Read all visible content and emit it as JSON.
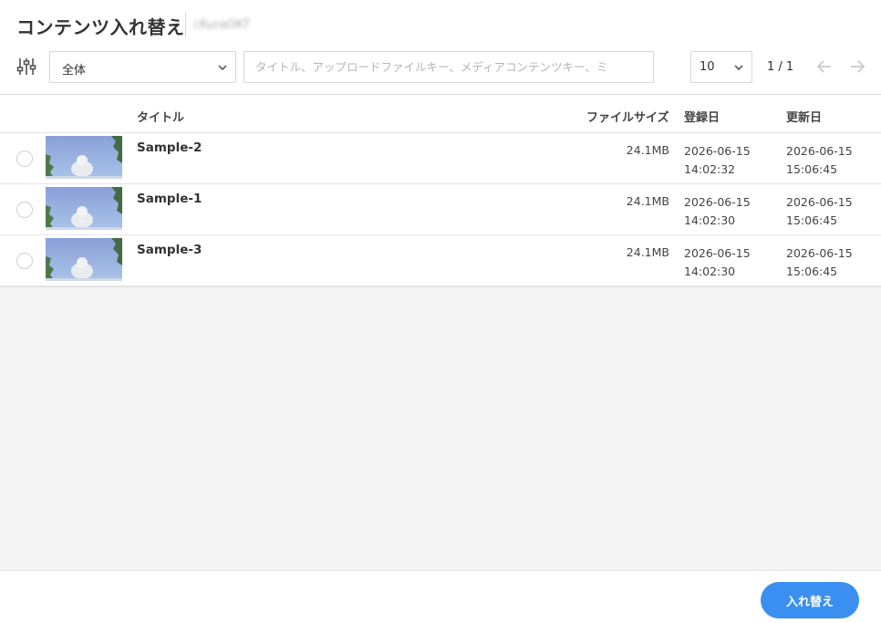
{
  "header": {
    "title": "コンテンツ入れ替え",
    "subtitle": "cKuraOKT"
  },
  "toolbar": {
    "filter_icon": "sliders-icon",
    "category_select": {
      "selected": "全体"
    },
    "search": {
      "placeholder": "タイトル、アップロードファイルキー、メディアコンテンツキー、ミ",
      "value": ""
    },
    "per_page": {
      "selected": "10"
    },
    "page_info": "1 / 1"
  },
  "table": {
    "columns": {
      "title": "タイトル",
      "file_size": "ファイルサイズ",
      "registered": "登録日",
      "updated": "更新日"
    },
    "rows": [
      {
        "title": "Sample-2",
        "size": "24.1MB",
        "registered_date": "2026-06-15",
        "registered_time": "14:02:32",
        "updated_date": "2026-06-15",
        "updated_time": "15:06:45"
      },
      {
        "title": "Sample-1",
        "size": "24.1MB",
        "registered_date": "2026-06-15",
        "registered_time": "14:02:30",
        "updated_date": "2026-06-15",
        "updated_time": "15:06:45"
      },
      {
        "title": "Sample-3",
        "size": "24.1MB",
        "registered_date": "2026-06-15",
        "registered_time": "14:02:30",
        "updated_date": "2026-06-15",
        "updated_time": "15:06:45"
      }
    ]
  },
  "footer": {
    "replace_label": "入れ替え"
  },
  "colors": {
    "accent": "#3b8ff0",
    "border": "#dcdcdc",
    "empty_bg": "#f4f4f4"
  }
}
